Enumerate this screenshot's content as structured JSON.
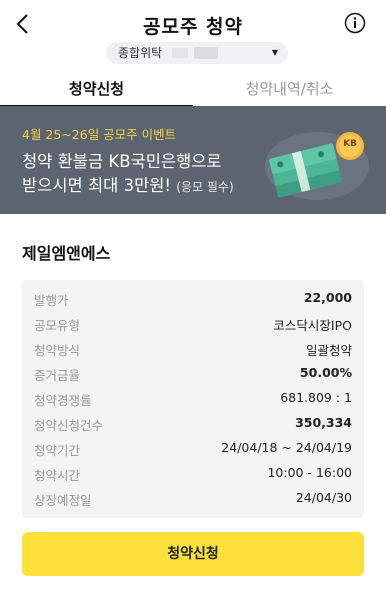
{
  "header": {
    "title": "공모주 청약"
  },
  "account": {
    "label": "종합위탁"
  },
  "tabs": [
    {
      "label": "청약신청",
      "active": true
    },
    {
      "label": "청약내역/취소",
      "active": false
    }
  ],
  "banner": {
    "subtitle": "4월 25~26일 공모주 이벤트",
    "line1": "청약 환불금 KB국민은행으로",
    "line2": "받으시면 최대 3만원!",
    "note": "(응모 필수)",
    "badge": "KB"
  },
  "company": {
    "name": "제일엠앤에스"
  },
  "details": [
    {
      "label": "발행가",
      "value": "22,000",
      "bold": true
    },
    {
      "label": "공모유형",
      "value": "코스닥시장IPO",
      "bold": false
    },
    {
      "label": "청약방식",
      "value": "일괄청약",
      "bold": false
    },
    {
      "label": "증거금율",
      "value": "50.00%",
      "bold": true
    },
    {
      "label": "청약경쟁률",
      "value": "681.809 : 1",
      "bold": false
    },
    {
      "label": "청약신청건수",
      "value": "350,334",
      "bold": true
    },
    {
      "label": "청약기간",
      "value": "24/04/18 ~ 24/04/19",
      "bold": false
    },
    {
      "label": "청약시간",
      "value": "10:00 - 16:00",
      "bold": false
    },
    {
      "label": "상장예정일",
      "value": "24/04/30",
      "bold": false
    }
  ],
  "cta": {
    "label": "청약신청"
  },
  "colors": {
    "accent": "#fde03a",
    "banner_bg": "#5c6470",
    "banner_highlight": "#f3d34a"
  }
}
